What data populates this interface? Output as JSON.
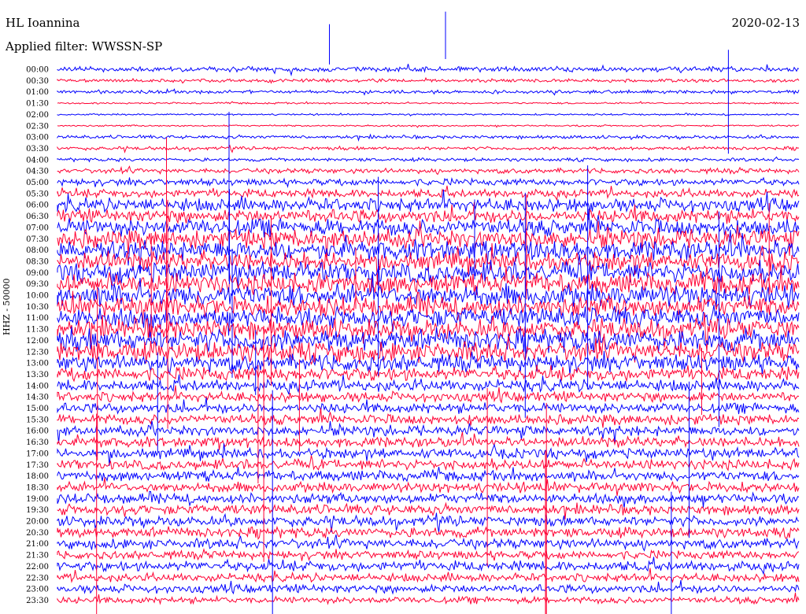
{
  "header": {
    "station": "HL Ioannina",
    "filter": "Applied filter: WWSSN-SP",
    "date": "2020-02-13"
  },
  "chart_data": {
    "type": "line",
    "title": "HL Ioannina",
    "subtitle": "Applied filter: WWSSN-SP",
    "ylabel": "HHZ - 50000",
    "rows": [
      "00:00",
      "00:30",
      "01:00",
      "01:30",
      "02:00",
      "02:30",
      "03:00",
      "03:30",
      "04:00",
      "04:30",
      "05:00",
      "05:30",
      "06:00",
      "06:30",
      "07:00",
      "07:30",
      "08:00",
      "08:30",
      "09:00",
      "09:30",
      "10:00",
      "10:30",
      "11:00",
      "11:30",
      "12:00",
      "12:30",
      "13:00",
      "13:30",
      "14:00",
      "14:30",
      "15:00",
      "15:30",
      "16:00",
      "16:30",
      "17:00",
      "17:30",
      "18:00",
      "18:30",
      "19:00",
      "19:30",
      "20:00",
      "20:30",
      "21:00",
      "21:30",
      "22:00",
      "22:30",
      "23:00",
      "23:30"
    ],
    "trace_colors": [
      "#0000ff",
      "#ff0033"
    ],
    "row_amplitude": [
      3,
      2,
      2,
      1,
      1,
      1,
      2,
      2,
      2,
      3,
      4,
      5,
      8,
      8,
      10,
      11,
      12,
      11,
      12,
      12,
      13,
      12,
      12,
      12,
      13,
      12,
      10,
      8,
      7,
      6,
      6,
      6,
      6,
      6,
      6,
      6,
      6,
      6,
      6,
      6,
      6,
      6,
      6,
      5,
      6,
      5,
      5,
      4
    ]
  }
}
